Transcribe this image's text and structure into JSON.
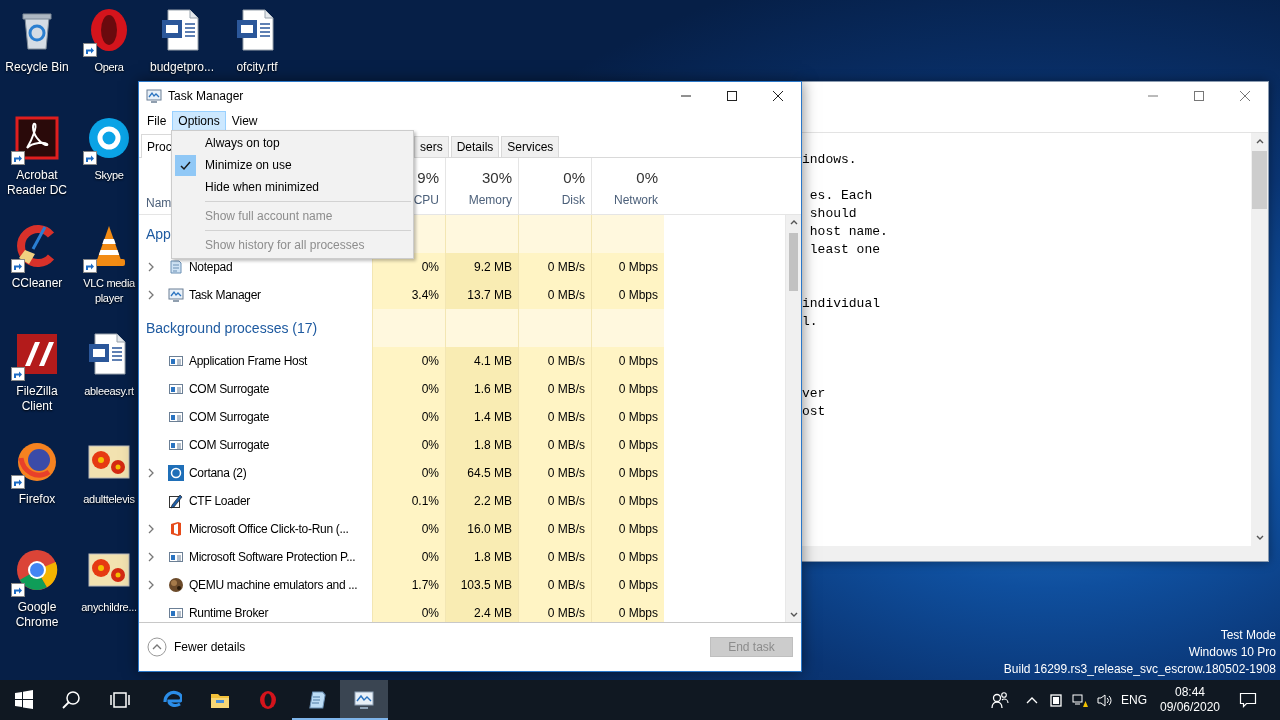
{
  "desktop": {
    "columns": [
      {
        "icons": [
          {
            "label": "Recycle Bin",
            "kind": "recycle",
            "shortcut": false
          },
          {
            "label": "Acrobat Reader DC",
            "kind": "acrobat",
            "shortcut": true
          },
          {
            "label": "CCleaner",
            "kind": "ccleaner",
            "shortcut": true
          },
          {
            "label": "FileZilla Client",
            "kind": "filezilla",
            "shortcut": true
          },
          {
            "label": "Firefox",
            "kind": "firefox",
            "shortcut": true
          },
          {
            "label": "Google Chrome",
            "kind": "chrome",
            "shortcut": true
          }
        ]
      },
      {
        "icons": [
          {
            "label": "Opera",
            "kind": "opera",
            "shortcut": true
          },
          {
            "label": "Skype",
            "kind": "skype",
            "shortcut": true
          },
          {
            "label": "VLC media player",
            "kind": "vlc",
            "shortcut": true
          },
          {
            "label": "ableeasy.rt",
            "kind": "word",
            "shortcut": false
          },
          {
            "label": "adulttelevis",
            "kind": "image",
            "shortcut": false
          },
          {
            "label": "anychildre...",
            "kind": "image",
            "shortcut": false
          }
        ]
      },
      {
        "icons": [
          {
            "label": "budgetpro...",
            "kind": "word",
            "shortcut": false
          }
        ]
      },
      {
        "icons": [
          {
            "label": "ofcity.rtf",
            "kind": "word",
            "shortcut": false
          }
        ]
      }
    ],
    "notice": [
      "Test Mode",
      "Windows 10 Pro",
      "Build 16299.rs3_release_svc_escrow.180502-1908"
    ]
  },
  "notepad_window": {
    "lines": [
      {
        "kind": "text",
        "text": "indows."
      },
      {
        "kind": "blank"
      },
      {
        "kind": "text",
        "text": " es. Each"
      },
      {
        "kind": "text",
        "text": " should"
      },
      {
        "kind": "text",
        "text": " host name."
      },
      {
        "kind": "text",
        "text": " least one"
      },
      {
        "kind": "blank"
      },
      {
        "kind": "blank"
      },
      {
        "kind": "text",
        "text": "individual"
      },
      {
        "kind": "text",
        "text": "l."
      },
      {
        "kind": "blank"
      },
      {
        "kind": "blank"
      },
      {
        "kind": "blank"
      },
      {
        "kind": "text",
        "text": "ver"
      },
      {
        "kind": "text",
        "text": "ost"
      }
    ]
  },
  "task_manager": {
    "title": "Task Manager",
    "menu": [
      {
        "label": "File",
        "selected": false
      },
      {
        "label": "Options",
        "selected": true
      },
      {
        "label": "View",
        "selected": false
      }
    ],
    "options_menu": [
      {
        "label": "Always on top",
        "checked": false,
        "disabled": false,
        "separator_before": false
      },
      {
        "label": "Minimize on use",
        "checked": true,
        "disabled": false,
        "separator_before": false
      },
      {
        "label": "Hide when minimized",
        "checked": false,
        "disabled": false,
        "separator_before": false
      },
      {
        "label": "Show full account name",
        "checked": false,
        "disabled": true,
        "separator_before": true
      },
      {
        "label": "Show history for all processes",
        "checked": false,
        "disabled": true,
        "separator_before": true
      }
    ],
    "tabs": [
      {
        "label": "Proc",
        "selected": true
      },
      {
        "label": "sers",
        "selected": false
      },
      {
        "label": "Details",
        "selected": false
      },
      {
        "label": "Services",
        "selected": false
      }
    ],
    "columns": [
      {
        "label": "Nam",
        "kind": "name"
      },
      {
        "label": "CPU",
        "usage": "9%",
        "kind": "metric"
      },
      {
        "label": "Memory",
        "usage": "30%",
        "kind": "metric"
      },
      {
        "label": "Disk",
        "usage": "0%",
        "kind": "metric"
      },
      {
        "label": "Network",
        "usage": "0%",
        "kind": "metric"
      }
    ],
    "groups": [
      {
        "title": "App",
        "rows": [
          {
            "name": "Notepad",
            "kind": "notepad",
            "expandable": true,
            "cpu": "0%",
            "memory": "9.2 MB",
            "disk": "0 MB/s",
            "network": "0 Mbps"
          },
          {
            "name": "Task Manager",
            "kind": "taskmgr",
            "expandable": true,
            "cpu": "3.4%",
            "memory": "13.7 MB",
            "disk": "0 MB/s",
            "network": "0 Mbps"
          }
        ]
      },
      {
        "title": "Background processes (17)",
        "rows": [
          {
            "name": "Application Frame Host",
            "kind": "window",
            "expandable": false,
            "cpu": "0%",
            "memory": "4.1 MB",
            "disk": "0 MB/s",
            "network": "0 Mbps"
          },
          {
            "name": "COM Surrogate",
            "kind": "window",
            "expandable": false,
            "cpu": "0%",
            "memory": "1.6 MB",
            "disk": "0 MB/s",
            "network": "0 Mbps"
          },
          {
            "name": "COM Surrogate",
            "kind": "window",
            "expandable": false,
            "cpu": "0%",
            "memory": "1.4 MB",
            "disk": "0 MB/s",
            "network": "0 Mbps"
          },
          {
            "name": "COM Surrogate",
            "kind": "window",
            "expandable": false,
            "cpu": "0%",
            "memory": "1.8 MB",
            "disk": "0 MB/s",
            "network": "0 Mbps"
          },
          {
            "name": "Cortana (2)",
            "kind": "cortana",
            "expandable": true,
            "cpu": "0%",
            "memory": "64.5 MB",
            "disk": "0 MB/s",
            "network": "0 Mbps"
          },
          {
            "name": "CTF Loader",
            "kind": "pen",
            "expandable": false,
            "cpu": "0.1%",
            "memory": "2.2 MB",
            "disk": "0 MB/s",
            "network": "0 Mbps"
          },
          {
            "name": "Microsoft Office Click-to-Run (...",
            "kind": "office",
            "expandable": true,
            "cpu": "0%",
            "memory": "16.0 MB",
            "disk": "0 MB/s",
            "network": "0 Mbps"
          },
          {
            "name": "Microsoft Software Protection P...",
            "kind": "window",
            "expandable": true,
            "cpu": "0%",
            "memory": "1.8 MB",
            "disk": "0 MB/s",
            "network": "0 Mbps"
          },
          {
            "name": "QEMU machine emulators and ...",
            "kind": "ball",
            "expandable": true,
            "cpu": "1.7%",
            "memory": "103.5 MB",
            "disk": "0 MB/s",
            "network": "0 Mbps"
          },
          {
            "name": "Runtime Broker",
            "kind": "window",
            "expandable": false,
            "cpu": "0%",
            "memory": "2.4 MB",
            "disk": "0 MB/s",
            "network": "0 Mbps"
          }
        ]
      }
    ],
    "footer": {
      "fewer_details": "Fewer details",
      "end_task": {
        "label": "End task",
        "disabled": true
      }
    }
  },
  "taskbar": {
    "apps": [
      {
        "kind": "start",
        "running": false,
        "active": false
      },
      {
        "kind": "search",
        "running": false,
        "active": false
      },
      {
        "kind": "taskview",
        "running": false,
        "active": false
      },
      {
        "kind": "edge",
        "running": false,
        "active": false
      },
      {
        "kind": "explorer",
        "running": false,
        "active": false
      },
      {
        "kind": "opera",
        "running": false,
        "active": false
      },
      {
        "kind": "notepad",
        "running": true,
        "active": false
      },
      {
        "kind": "taskmgr",
        "running": true,
        "active": true
      }
    ],
    "tray": {
      "language": "ENG",
      "time": "08:44",
      "date": "09/06/2020"
    }
  }
}
